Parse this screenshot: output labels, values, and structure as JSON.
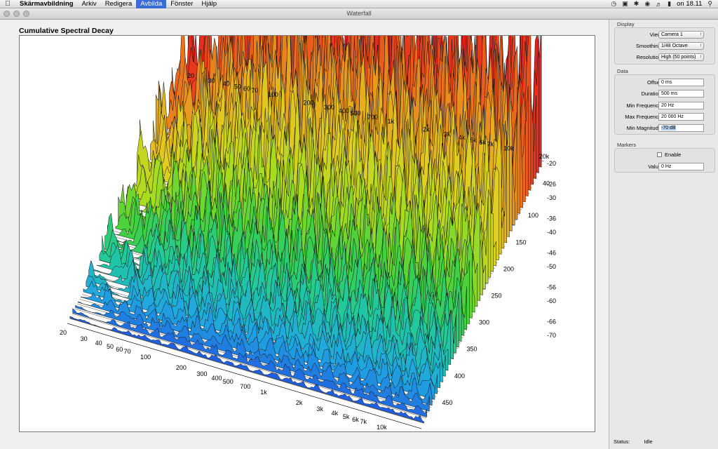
{
  "menubar": {
    "app": "Skärmavbildning",
    "items": [
      "Arkiv",
      "Redigera",
      "Avbilda",
      "Fönster",
      "Hjälp"
    ],
    "active_item": "Avbilda",
    "clock": "on 18.11"
  },
  "window": {
    "title": "Waterfall"
  },
  "plot": {
    "title": "Cumulative Spectral Decay"
  },
  "chart_data": {
    "type": "waterfall",
    "title": "Cumulative Spectral Decay",
    "frequency_axis": {
      "scale": "log",
      "range": [
        20,
        20000
      ],
      "ticks": [
        "20",
        "30",
        "40",
        "50",
        "60",
        "70",
        "100",
        "200",
        "300",
        "400",
        "500",
        "700",
        "1k",
        "2k",
        "3k",
        "4k",
        "5k",
        "6k",
        "7k",
        "10k",
        "20k"
      ],
      "tick_values": [
        20,
        30,
        40,
        50,
        60,
        70,
        100,
        200,
        300,
        400,
        500,
        700,
        1000,
        2000,
        3000,
        4000,
        5000,
        6000,
        7000,
        10000,
        20000
      ]
    },
    "time_axis": {
      "unit": "ms",
      "range": [
        0,
        500
      ],
      "ticks": [
        "40",
        "100",
        "150",
        "200",
        "250",
        "300",
        "350",
        "400",
        "450"
      ]
    },
    "magnitude_axis": {
      "unit": "dB",
      "range": [
        -70,
        -20
      ],
      "ticks": [
        "-20",
        "-26",
        "-30",
        "-36",
        "-40",
        "-46",
        "-50",
        "-56",
        "-60",
        "-66",
        "-70"
      ]
    },
    "colormap": [
      "#e8141e",
      "#e85a1e",
      "#e8a01e",
      "#e0d020",
      "#a8dc20",
      "#40d040",
      "#20c8a0",
      "#20a8e0",
      "#2050e0"
    ]
  },
  "side": {
    "display": {
      "title": "Display",
      "view_label": "View:",
      "view_value": "Camera 1",
      "smoothing_label": "Smoothing:",
      "smoothing_value": "1/48 Octave",
      "resolution_label": "Resolution:",
      "resolution_value": "High (50 points)"
    },
    "data": {
      "title": "Data",
      "offset_label": "Offset:",
      "offset_value": "0 ms",
      "duration_label": "Duration:",
      "duration_value": "500 ms",
      "minfreq_label": "Min Frequency:",
      "minfreq_value": "20 Hz",
      "maxfreq_label": "Max Frequency:",
      "maxfreq_value": "20 000 Hz",
      "minmag_label": "Min Magnitude:",
      "minmag_value": "-70 dB"
    },
    "markers": {
      "title": "Markers",
      "enable_label": "Enable",
      "value_label": "Value:",
      "value_value": "0 Hz"
    },
    "status_label": "Status:",
    "status_value": "Idle"
  }
}
